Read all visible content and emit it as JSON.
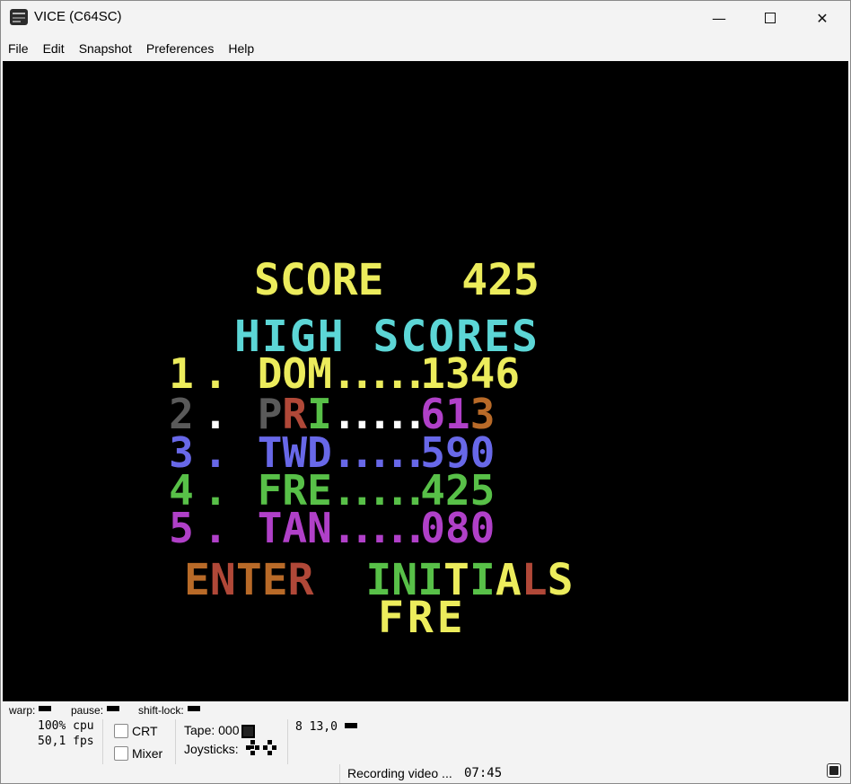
{
  "window": {
    "title": "VICE (C64SC)",
    "controls": {
      "minimize": "—",
      "close": "✕"
    }
  },
  "menu": [
    "File",
    "Edit",
    "Snapshot",
    "Preferences",
    "Help"
  ],
  "game": {
    "score_label": "SCORE",
    "score_value": "425",
    "high_scores_title": "HIGH SCORES",
    "entries": [
      {
        "rank": "1",
        "name": "DOM",
        "dots": ".....",
        "score": "1346"
      },
      {
        "rank": "2",
        "name": "PRI",
        "dots": ".....",
        "score": "613"
      },
      {
        "rank": "3",
        "name": "TWD",
        "dots": ".....",
        "score": "590"
      },
      {
        "rank": "4",
        "name": "FRE",
        "dots": ".....",
        "score": "425"
      },
      {
        "rank": "5",
        "name": "TAN",
        "dots": ".....",
        "score": "080"
      }
    ],
    "enter_label": "ENTER",
    "initials_label": "INITIALS",
    "current_initials": "FRE",
    "colors": {
      "yellow": "#ecec5c",
      "cyan": "#5cd6d6",
      "grey": "#5a5a5a",
      "red": "#b04838",
      "orange": "#b86a28",
      "magenta": "#b040c8",
      "blue": "#6868e8",
      "green": "#58c048",
      "white": "#ffffff",
      "brown": "#9a5a2a"
    }
  },
  "status": {
    "warp_label": "warp:",
    "pause_label": "pause:",
    "shiftlock_label": "shift-lock:",
    "cpu": "100% cpu",
    "fps": "50,1 fps",
    "crt_label": "CRT",
    "mixer_label": "Mixer",
    "tape_label": "Tape:",
    "tape_counter": "000",
    "joysticks_label": "Joysticks:",
    "drive_info": "8 13,0",
    "recording_label": "Recording video ...",
    "recording_time": "07:45"
  }
}
